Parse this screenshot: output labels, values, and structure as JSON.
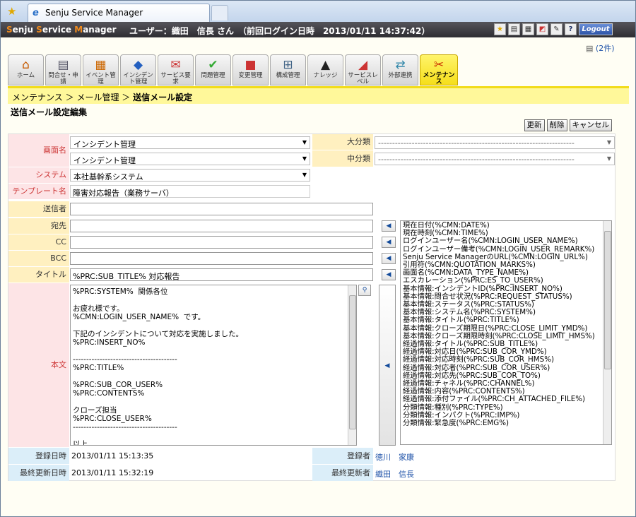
{
  "browser": {
    "tab_title": "Senju Service Manager"
  },
  "app": {
    "logo_a": "S",
    "logo_b": "enju ",
    "logo_c": "S",
    "logo_d": "ervice ",
    "logo_e": "M",
    "logo_f": "anager",
    "user_info": "ユーザー：織田　信長 さん　（前回ログイン日時　2013/01/11 14:37:42）",
    "logout": "Logout",
    "count": "(2件)"
  },
  "nav": [
    {
      "label": "ホーム",
      "icon": "🏠"
    },
    {
      "label": "問合せ・申請",
      "icon": "📋"
    },
    {
      "label": "イベント管理",
      "icon": "📅"
    },
    {
      "label": "インシデント管理",
      "icon": "🚗"
    },
    {
      "label": "サービス要求",
      "icon": "📑"
    },
    {
      "label": "問題管理",
      "icon": "✔"
    },
    {
      "label": "変更管理",
      "icon": "🧊"
    },
    {
      "label": "構成管理",
      "icon": "🖧"
    },
    {
      "label": "ナレッジ",
      "icon": "🎓"
    },
    {
      "label": "サービスレベル",
      "icon": "📈"
    },
    {
      "label": "外部連携",
      "icon": "🔗"
    },
    {
      "label": "メンテナンス",
      "icon": "🔧"
    }
  ],
  "breadcrumb": {
    "p1": "メンテナンス",
    "sep1": "＞",
    "p2": "メール管理",
    "sep2": "＞",
    "current": "送信メール設定"
  },
  "page_title": "送信メール設定編集",
  "buttons": {
    "update": "更新",
    "delete": "削除",
    "cancel": "キャンセル"
  },
  "form": {
    "screen_label": "画面名",
    "screen1": "インシデント管理",
    "screen2": "インシデント管理",
    "major_label": "大分類",
    "major_value": "----------------------------------------------------------------------",
    "minor_label": "中分類",
    "minor_value": "----------------------------------------------------------------------",
    "system_label": "システム",
    "system_value": "本社基幹系システム",
    "template_label": "テンプレート名",
    "template_value": "障害対応報告（業務サーバ）",
    "sender_label": "送信者",
    "sender_value": "",
    "to_label": "宛先",
    "to_value": "",
    "cc_label": "CC",
    "cc_value": "",
    "bcc_label": "BCC",
    "bcc_value": "",
    "title_label": "タイトル",
    "title_value": "%PRC:SUB_TITLE%  対応報告",
    "body_label": "本文",
    "body_value": "%PRC:SYSTEM%  関係各位\n\nお疲れ様です。\n%CMN:LOGIN_USER_NAME%  です。\n\n下記のインシデントについて対応を実施しました。\n%PRC:INSERT_NO%\n\n---------------------------------------\n%PRC:TITLE%\n\n%PRC:SUB_COR_USER%\n%PRC:CONTENTS%\n\nクローズ担当\n%PRC:CLOSE_USER%\n---------------------------------------\n\n以上",
    "reg_date_label": "登録日時",
    "reg_date": "2013/01/11 15:13:35",
    "reg_user_label": "登録者",
    "reg_user": "徳川　家康",
    "upd_date_label": "最終更新日時",
    "upd_date": "2013/01/11 15:32:19",
    "upd_user_label": "最終更新者",
    "upd_user": "織田　信長"
  },
  "variables": [
    "現在日付(%CMN:DATE%)",
    "現在時刻(%CMN:TIME%)",
    "ログインユーザー名(%CMN:LOGIN_USER_NAME%)",
    "ログインユーザー備考(%CMN:LOGIN_USER_REMARK%)",
    "Senju Service ManagerのURL(%CMN:LOGIN_URL%)",
    "引用符(%CMN:QUOTATION_MARKS%)",
    "画面名(%CMN:DATA_TYPE_NAME%)",
    "エスカレーション(%PRC:ES_TO_USER%)",
    "基本情報:インシデントID(%PRC:INSERT_NO%)",
    "基本情報:問合せ状況(%PRC:REQUEST_STATUS%)",
    "基本情報:ステータス(%PRC:STATUS%)",
    "基本情報:システム名(%PRC:SYSTEM%)",
    "基本情報:タイトル(%PRC:TITLE%)",
    "基本情報:クローズ期限日(%PRC:CLOSE_LIMIT_YMD%)",
    "基本情報:クローズ期限時刻(%PRC:CLOSE_LIMIT_HMS%)",
    "経過情報:タイトル(%PRC:SUB_TITLE%)",
    "経過情報:対応日(%PRC:SUB_COR_YMD%)",
    "経過情報:対応時刻(%PRC:SUB_COR_HMS%)",
    "経過情報:対応者(%PRC:SUB_COR_USER%)",
    "経過情報:対応先(%PRC:SUB_COR_TO%)",
    "経過情報:チャネル(%PRC:CHANNEL%)",
    "経過情報:内容(%PRC:CONTENTS%)",
    "経過情報:添付ファイル(%PRC:CH_ATTACHED_FILE%)",
    "分類情報:種別(%PRC:TYPE%)",
    "分類情報:インパクト(%PRC:IMP%)",
    "分類情報:緊急度(%PRC:EMG%)"
  ]
}
